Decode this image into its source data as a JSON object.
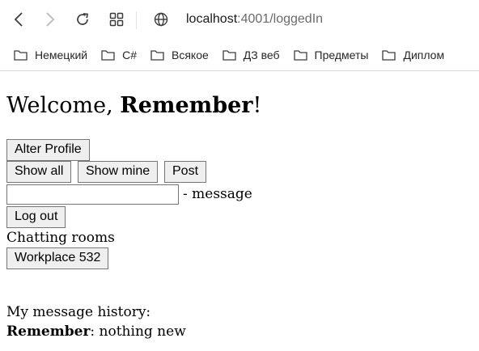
{
  "browser": {
    "url_host": "localhost",
    "url_path": ":4001/loggedIn",
    "bookmarks": [
      "Немецкий",
      "C#",
      "Всякое",
      "ДЗ веб",
      "Предметы",
      "Диплом"
    ]
  },
  "page": {
    "welcome_prefix": "Welcome, ",
    "username": "Remember",
    "welcome_suffix": "!",
    "alter_profile_label": "Alter Profile",
    "show_all_label": "Show all",
    "show_mine_label": "Show mine",
    "post_label": "Post",
    "message_input_value": "",
    "message_hint": "- message",
    "logout_label": "Log out",
    "chatting_rooms_title": "Chatting rooms",
    "rooms": [
      "Workplace 532"
    ],
    "history_title": "My message history:",
    "history": [
      {
        "author": "Remember",
        "separator": ": ",
        "text": "nothing new"
      }
    ]
  }
}
